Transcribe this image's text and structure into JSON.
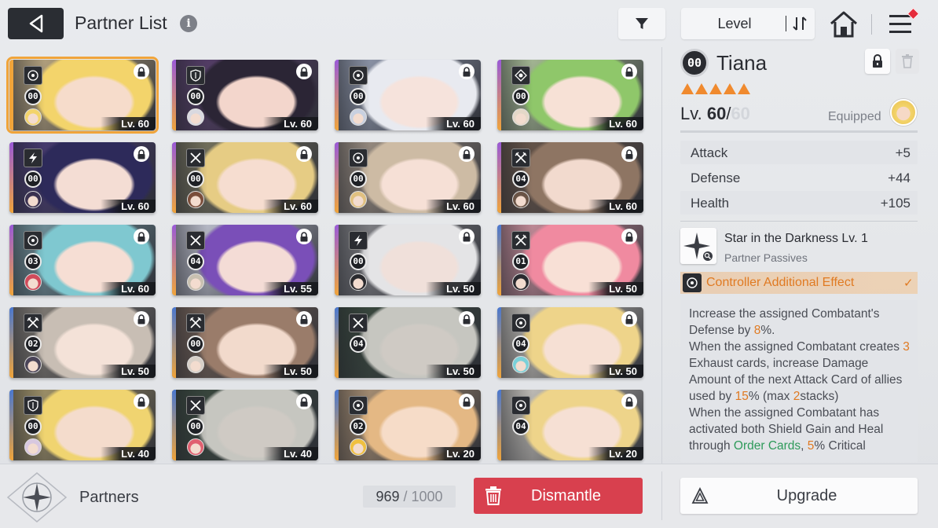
{
  "header": {
    "title": "Partner List",
    "info_glyph": "i",
    "sort_label": "Level"
  },
  "cards": [
    {
      "rank": "00",
      "level": "Lv. 60",
      "class_icon": "target-icon",
      "hair": "#f3d46b",
      "skin": "#f6dccb",
      "bg": "#c9b48a",
      "side": "#f0a43a",
      "equip": "#f3d46b",
      "selected": true
    },
    {
      "rank": "00",
      "level": "Lv. 60",
      "class_icon": "shield-icon",
      "hair": "#2b2535",
      "skin": "#f3d6cc",
      "bg": "#5a3f6e",
      "side": "#9a5ad8",
      "equip": "#d9d9e0"
    },
    {
      "rank": "00",
      "level": "Lv. 60",
      "class_icon": "target-icon",
      "hair": "#e8eaf0",
      "skin": "#f6e3dc",
      "bg": "#9aa3b8",
      "side": "#9a5ad8",
      "equip": "#c8d0e0"
    },
    {
      "rank": "00",
      "level": "Lv. 60",
      "class_icon": "diamond-target-icon",
      "hair": "#8fc76a",
      "skin": "#f7e1d6",
      "bg": "#b9cfa4",
      "side": "#9a5ad8",
      "equip": "#e4d8c8"
    },
    {
      "rank": "00",
      "level": "Lv. 60",
      "class_icon": "bolt-icon",
      "hair": "#2d2a5a",
      "skin": "#f4ddd4",
      "bg": "#4a3c78",
      "side": "#9a5ad8",
      "equip": "#3a3150"
    },
    {
      "rank": "00",
      "level": "Lv. 60",
      "class_icon": "swords-icon",
      "hair": "#e6cc84",
      "skin": "#f6ddd0",
      "bg": "#7d7a62",
      "side": "#9a5ad8",
      "equip": "#7a4d3a"
    },
    {
      "rank": "00",
      "level": "Lv. 60",
      "class_icon": "target-icon",
      "hair": "#cdbba4",
      "skin": "#f6e0d6",
      "bg": "#a89a8c",
      "side": "#9a5ad8",
      "equip": "#e0c080"
    },
    {
      "rank": "04",
      "level": "Lv. 60",
      "class_icon": "crossed-swords-icon",
      "hair": "#8e7563",
      "skin": "#f2dace",
      "bg": "#6e5a4c",
      "side": "#9a5ad8",
      "equip": "#6a5446"
    },
    {
      "rank": "03",
      "level": "Lv. 60",
      "class_icon": "target-icon",
      "hair": "#7fc8d0",
      "skin": "#f6ded4",
      "bg": "#7a9ea8",
      "side": "#9a5ad8",
      "equip": "#d04a5a"
    },
    {
      "rank": "04",
      "level": "Lv. 55",
      "class_icon": "swords-icon",
      "hair": "#7a4fb8",
      "skin": "#f4dcd6",
      "bg": "#cfd2e0",
      "side": "#9a5ad8",
      "equip": "#c8c0b0"
    },
    {
      "rank": "00",
      "level": "Lv. 50",
      "class_icon": "bolt-icon",
      "hair": "#e4e4e6",
      "skin": "#f0e0da",
      "bg": "#8a8a8e",
      "side": "#9a5ad8",
      "equip": "#2a2a2e"
    },
    {
      "rank": "01",
      "level": "Lv. 50",
      "class_icon": "crossed-swords-icon",
      "hair": "#f08aa0",
      "skin": "#f8e0d6",
      "bg": "#d99aa8",
      "side": "#4a78d0",
      "equip": "#2a2a30"
    },
    {
      "rank": "02",
      "level": "Lv. 50",
      "class_icon": "crossed-swords-icon",
      "hair": "#c8beb4",
      "skin": "#f4e2d8",
      "bg": "#8a847c",
      "side": "#4a78d0",
      "equip": "#4a4458"
    },
    {
      "rank": "00",
      "level": "Lv. 50",
      "class_icon": "crossed-swords-icon",
      "hair": "#9a7c6a",
      "skin": "#f2dacc",
      "bg": "#7a665a",
      "side": "#4a78d0",
      "equip": "#d8d0c8"
    },
    {
      "rank": "04",
      "level": "Lv. 50",
      "class_icon": "swords-icon",
      "hair": "#c6c6c0",
      "skin": "#cfcac4",
      "bg": "#3a4a3e",
      "side": "#4a78d0",
      "equip": "none"
    },
    {
      "rank": "04",
      "level": "Lv. 50",
      "class_icon": "target-icon",
      "hair": "#eed48a",
      "skin": "#f6e0d4",
      "bg": "#d8d4cc",
      "side": "#4a78d0",
      "equip": "#7ad0d8"
    },
    {
      "rank": "00",
      "level": "Lv. 40",
      "class_icon": "shield-icon",
      "hair": "#f0d470",
      "skin": "#f4dccc",
      "bg": "#b0a070",
      "side": "#4a78d0",
      "equip": "#d8c8e0"
    },
    {
      "rank": "00",
      "level": "Lv. 40",
      "class_icon": "swords-icon",
      "hair": "#c6c6c0",
      "skin": "#cfcac4",
      "bg": "#3a4a3e",
      "side": "#4a78d0",
      "equip": "#e06070"
    },
    {
      "rank": "02",
      "level": "Lv. 20",
      "class_icon": "target-icon",
      "hair": "#e4b884",
      "skin": "#f6dcc8",
      "bg": "#b89c7c",
      "side": "#4a78d0",
      "equip": "#f0c040"
    },
    {
      "rank": "04",
      "level": "Lv. 20",
      "class_icon": "target-icon",
      "hair": "#eed48a",
      "skin": "#f6e0d4",
      "bg": "#d8d4cc",
      "side": "#4a78d0",
      "equip": "none"
    }
  ],
  "detail": {
    "rank": "00",
    "name": "Tiana",
    "stars": 5,
    "level_prefix": "Lv. ",
    "level_current": "60",
    "level_sep": "/",
    "level_max": "60",
    "equipped_label": "Equipped",
    "stats": [
      {
        "name": "Attack",
        "value": "+5"
      },
      {
        "name": "Defense",
        "value": "+44"
      },
      {
        "name": "Health",
        "value": "+105"
      }
    ],
    "passive_name": "Star in the Darkness Lv. 1",
    "passive_sub": "Partner Passives",
    "effect_label": "Controller Additional Effect",
    "effect_check": "✓",
    "desc": {
      "p1a": "Increase the assigned Combatant's Defense by ",
      "p1v": "8",
      "p1b": "%.",
      "p2a": "When the assigned Combatant creates ",
      "p2v": "3",
      "p2b": " Exhaust cards, increase Damage Amount of the next Attack Card of allies used by ",
      "p2v2": "15",
      "p2c": "% (max ",
      "p2v3": "2",
      "p2d": "stacks)",
      "p3a": "When the assigned Combatant has activated both Shield Gain and Heal through ",
      "p3g": "Order Cards",
      "p3b": ", ",
      "p3v": "5",
      "p3c": "% Critical"
    }
  },
  "footer": {
    "label": "Partners",
    "capacity_current": "969",
    "capacity_sep": " / ",
    "capacity_max": "1000",
    "dismantle_label": "Dismantle",
    "upgrade_label": "Upgrade"
  },
  "colors": {
    "accent_orange": "#e07a22",
    "dismantle_red": "#d8404e",
    "selected_outline": "#f0a43a"
  }
}
